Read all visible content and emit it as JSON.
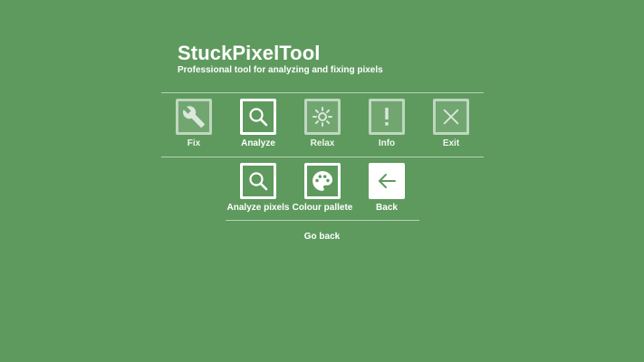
{
  "app": {
    "title": "StuckPixelTool",
    "subtitle": "Professional tool for analyzing and fixing pixels"
  },
  "main_menu": [
    {
      "label": "Fix",
      "icon": "wrench-icon"
    },
    {
      "label": "Analyze",
      "icon": "magnifier-icon"
    },
    {
      "label": "Relax",
      "icon": "sun-icon"
    },
    {
      "label": "Info",
      "icon": "exclamation-icon"
    },
    {
      "label": "Exit",
      "icon": "close-icon"
    }
  ],
  "sub_menu": [
    {
      "label": "Analyze pixels",
      "icon": "magnifier-icon"
    },
    {
      "label": "Colour pallete",
      "icon": "palette-icon"
    },
    {
      "label": "Back",
      "icon": "arrow-left-icon"
    }
  ],
  "footer": {
    "go_back": "Go back"
  },
  "colors": {
    "background": "#5e9a5e",
    "foreground": "#ffffff"
  }
}
